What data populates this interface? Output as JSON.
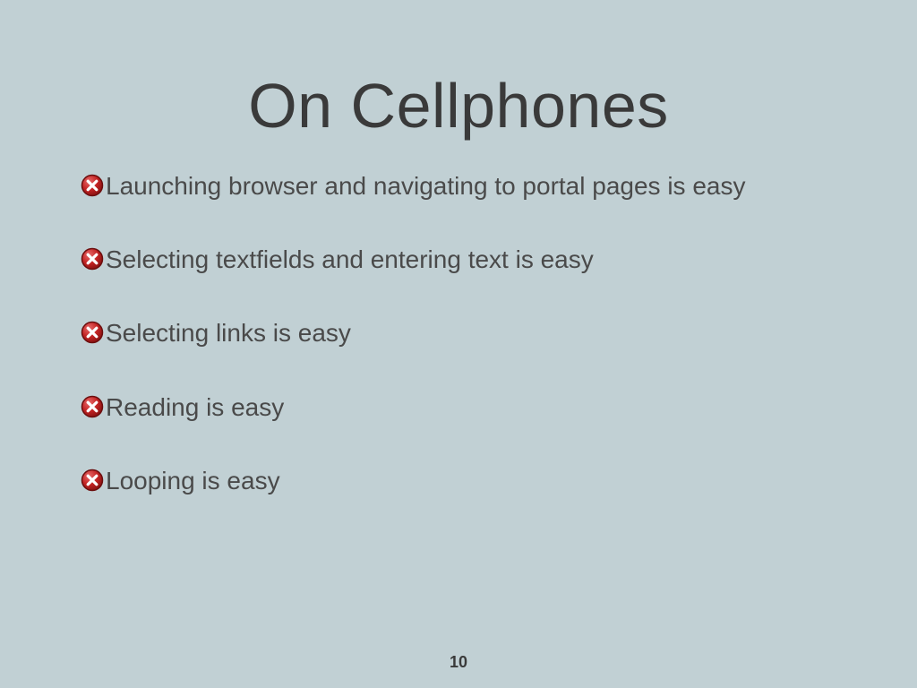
{
  "title": "On Cellphones",
  "bullets": [
    "Launching browser and navigating to portal pages is easy",
    "Selecting textfields and entering text is easy",
    "Selecting links is easy",
    "Reading is easy",
    "Looping is easy"
  ],
  "page_number": "10",
  "icon_semantic": "cross-circle-icon",
  "colors": {
    "background": "#c1d0d4",
    "text": "#4a4a4a",
    "title": "#3a3a3a",
    "icon_fill": "#b21818",
    "icon_border": "#7a0f0f"
  }
}
